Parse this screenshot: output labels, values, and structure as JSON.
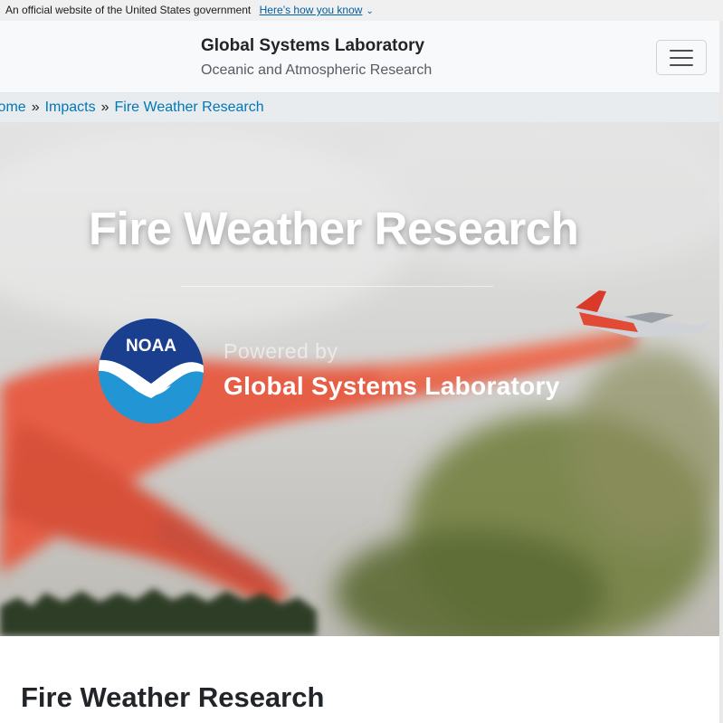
{
  "gov_banner": {
    "text": "An official website of the United States government",
    "link": "Here’s how you know",
    "chevron": "⌄"
  },
  "header": {
    "title": "Global Systems Laboratory",
    "subtitle": "Oceanic and Atmospheric Research",
    "menu_icon": "hamburger-icon"
  },
  "breadcrumb": {
    "items": [
      "Home",
      "Impacts",
      "Fire Weather Research"
    ],
    "separator": "»"
  },
  "hero": {
    "title": "Fire Weather Research",
    "logo_text": "NOAA",
    "powered_by": "Powered by",
    "lab_name": "Global Systems Laboratory"
  },
  "main": {
    "heading": "Fire Weather Research"
  },
  "colors": {
    "link": "#0077b6",
    "gov_link": "#005ea2",
    "noaa_blue": "#1e5aa8",
    "retardant": "#e8553b"
  }
}
